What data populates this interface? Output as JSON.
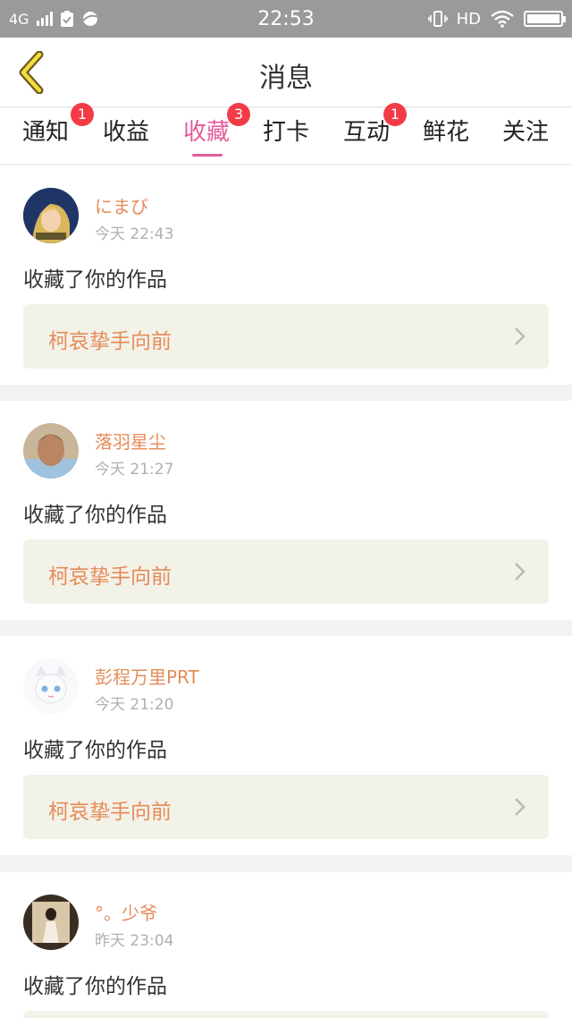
{
  "status_bar": {
    "network": "4G",
    "time": "22:53",
    "hd": "HD"
  },
  "header": {
    "title": "消息"
  },
  "tabs": [
    {
      "label": "通知",
      "badge": "1"
    },
    {
      "label": "收益",
      "badge": ""
    },
    {
      "label": "收藏",
      "badge": "3",
      "active": true
    },
    {
      "label": "打卡",
      "badge": ""
    },
    {
      "label": "互动",
      "badge": "1"
    },
    {
      "label": "鲜花",
      "badge": ""
    },
    {
      "label": "关注",
      "badge": ""
    }
  ],
  "messages": [
    {
      "user": "にまび",
      "time": "今天 22:43",
      "action": "收藏了你的作品",
      "work": "柯哀挚手向前"
    },
    {
      "user": "落羽星尘",
      "time": "今天 21:27",
      "action": "收藏了你的作品",
      "work": "柯哀挚手向前"
    },
    {
      "user": "彭程万里PRT",
      "time": "今天 21:20",
      "action": "收藏了你的作品",
      "work": "柯哀挚手向前"
    },
    {
      "user": "°。少爷",
      "time": "昨天 23:04",
      "action": "收藏了你的作品",
      "work": ""
    }
  ],
  "colors": {
    "accent_pink": "#e45c9a",
    "badge_red": "#f23b47",
    "username_orange": "#e58c5a",
    "work_bg": "#f3f2e8"
  }
}
